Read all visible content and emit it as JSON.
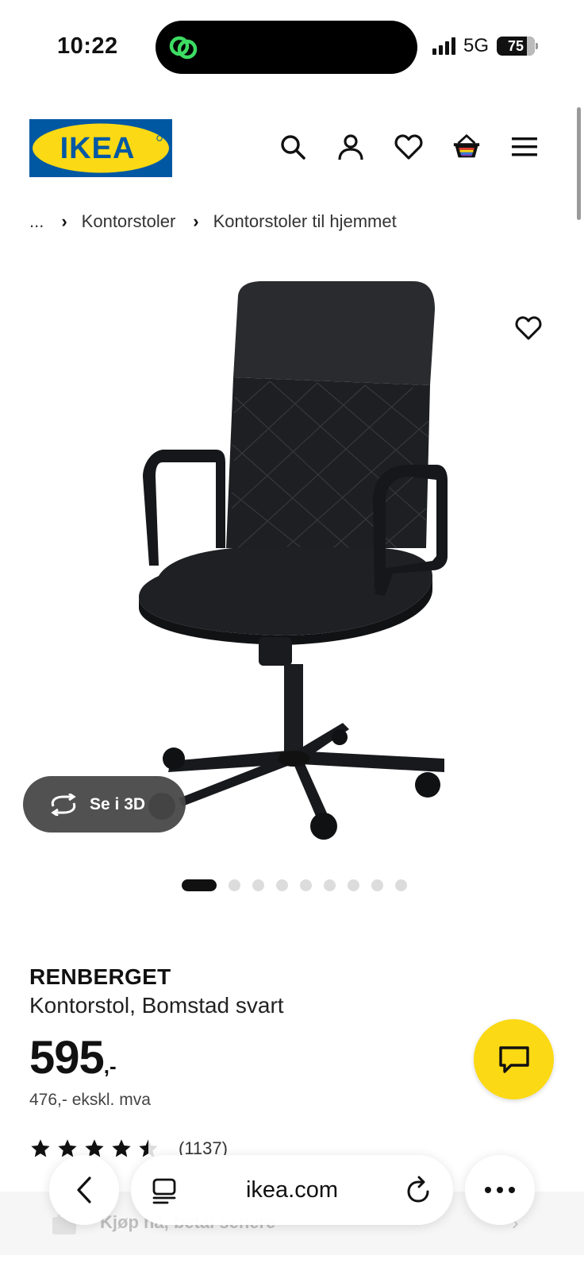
{
  "status_bar": {
    "time": "10:22",
    "network": "5G",
    "battery": "75"
  },
  "header": {
    "logo_text": "IKEA",
    "icons": [
      "search-icon",
      "profile-icon",
      "heart-icon",
      "basket-icon",
      "menu-icon"
    ]
  },
  "breadcrumb": {
    "items": [
      "...",
      "Kontorstoler",
      "Kontorstoler til hjemmet"
    ]
  },
  "gallery": {
    "view_3d_label": "Se i 3D",
    "total_images": 9,
    "active_index": 0
  },
  "product": {
    "name": "RENBERGET",
    "description": "Kontorstol, Bomstad svart",
    "price": "595",
    "price_suffix": ",-",
    "price_ex_vat": "476,- ekskl. mva",
    "rating": 4.5,
    "review_count": "(1137)"
  },
  "payment": {
    "klarna_label": "Kjøp nå, betal senere"
  },
  "browser": {
    "url": "ikea.com"
  },
  "colors": {
    "ikea_blue": "#0058a3",
    "ikea_yellow": "#fbd914",
    "text": "#111111"
  }
}
